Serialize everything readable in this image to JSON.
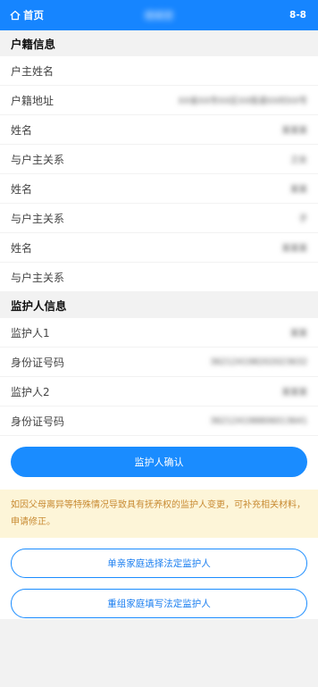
{
  "header": {
    "home_label": "首页",
    "title": "婚姻登",
    "right": "8-8"
  },
  "household": {
    "section_title": "户籍信息",
    "rows": [
      {
        "label": "户主姓名",
        "value": ""
      },
      {
        "label": "户籍地址",
        "value": "XX省XX市XX区XX街道XX村XX号"
      },
      {
        "label": "姓名",
        "value": "某某某"
      },
      {
        "label": "与户主关系",
        "value": "之女"
      },
      {
        "label": "姓名",
        "value": "某某"
      },
      {
        "label": "与户主关系",
        "value": "子"
      },
      {
        "label": "姓名",
        "value": "某某某"
      },
      {
        "label": "与户主关系",
        "value": ""
      }
    ]
  },
  "guardian": {
    "section_title": "监护人信息",
    "rows": [
      {
        "label": "监护人1",
        "value": "某某"
      },
      {
        "label": "身份证号码",
        "value": "362124198202023632"
      },
      {
        "label": "监护人2",
        "value": "某某某"
      },
      {
        "label": "身份证号码",
        "value": "362124198806013641"
      }
    ]
  },
  "confirm_button": "监护人确认",
  "notice": "如因父母离异等特殊情况导致具有抚养权的监护人变更，可补充相关材料，申请修正。",
  "options": {
    "single_parent": "单亲家庭选择法定监护人",
    "reorganized": "重组家庭填写法定监护人"
  },
  "colors": {
    "accent": "#1685ff",
    "notice_bg": "#fdf5d8",
    "notice_text": "#c88a32"
  }
}
